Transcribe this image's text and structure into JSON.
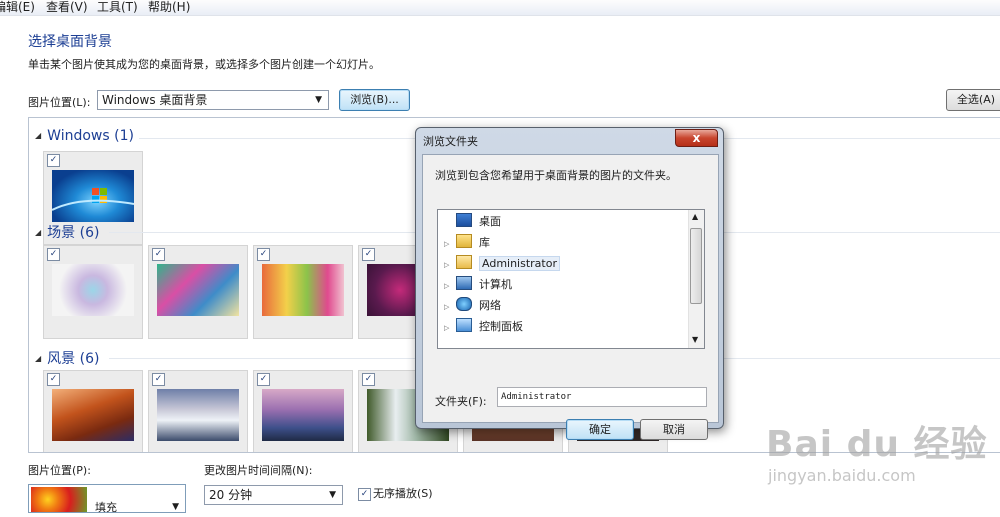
{
  "menubar": {
    "items": [
      "编辑(E)",
      "查看(V)",
      "工具(T)",
      "帮助(H)"
    ]
  },
  "header": {
    "title": "选择桌面背景",
    "subtitle": "单击某个图片使其成为您的桌面背景，或选择多个图片创建一个幻灯片。"
  },
  "location": {
    "label": "图片位置(L):",
    "value": "Windows 桌面背景",
    "browse_label": "浏览(B)...",
    "select_all_label": "全选(A)"
  },
  "groups": [
    {
      "title": "Windows (1)"
    },
    {
      "title": "场景 (6)"
    },
    {
      "title": "风景 (6)"
    }
  ],
  "bottom": {
    "position_label": "图片位置(P):",
    "position_value": "填充",
    "interval_label": "更改图片时间间隔(N):",
    "interval_value": "20 分钟",
    "shuffle_label": "无序播放(S)",
    "shuffle_checked": true
  },
  "dialog": {
    "title": "浏览文件夹",
    "close_label": "x",
    "prompt": "浏览到包含您希望用于桌面背景的图片的文件夹。",
    "tree": [
      {
        "label": "桌面",
        "icon": "desktop-icon"
      },
      {
        "label": "库",
        "icon": "library-icon"
      },
      {
        "label": "Administrator",
        "icon": "user-folder-icon"
      },
      {
        "label": "计算机",
        "icon": "computer-icon"
      },
      {
        "label": "网络",
        "icon": "network-icon"
      },
      {
        "label": "控制面板",
        "icon": "control-panel-icon"
      }
    ],
    "folder_label": "文件夹(F):",
    "folder_value": "Administrator",
    "ok_label": "确定",
    "cancel_label": "取消"
  },
  "watermark": {
    "brand": "Bai du 经验",
    "url": "jingyan.baidu.com"
  }
}
